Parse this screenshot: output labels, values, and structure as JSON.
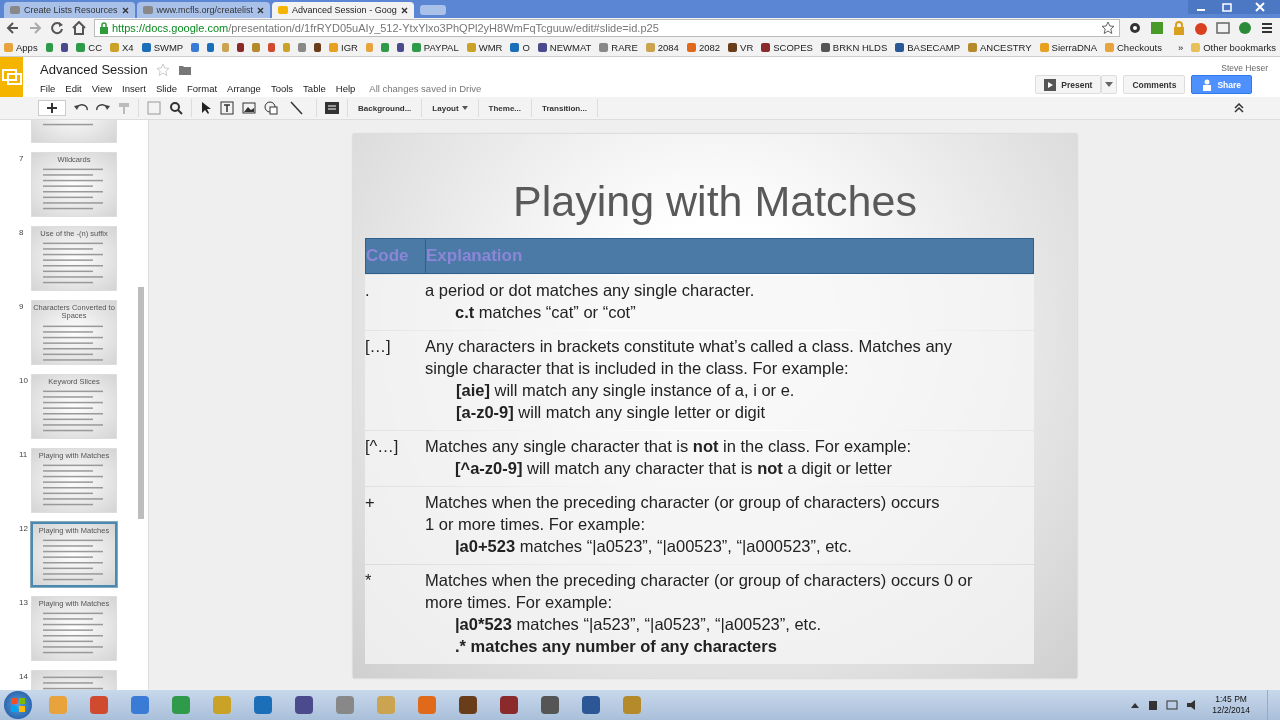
{
  "browser": {
    "tabs": [
      {
        "title": "Create Lists Resources",
        "selected": false
      },
      {
        "title": "www.mcfls.org/createlist",
        "selected": false
      },
      {
        "title": "Advanced Session - Goog",
        "selected": true
      }
    ],
    "url_host": "https://docs.google.com",
    "url_path": "/presentation/d/1frRYD05uAIy_512-YtxYlxo3PhQPl2yH8WmFqTcguuw/edit#slide=id.p25",
    "bookmarks": [
      {
        "kind": "labeled",
        "label": "Apps"
      },
      {
        "kind": "icon"
      },
      {
        "kind": "icon"
      },
      {
        "kind": "labeled",
        "label": "CC"
      },
      {
        "kind": "labeled",
        "label": "X4"
      },
      {
        "kind": "labeled",
        "label": "SWMP"
      },
      {
        "kind": "icon"
      },
      {
        "kind": "icon"
      },
      {
        "kind": "icon"
      },
      {
        "kind": "icon"
      },
      {
        "kind": "icon"
      },
      {
        "kind": "icon"
      },
      {
        "kind": "icon"
      },
      {
        "kind": "icon"
      },
      {
        "kind": "icon"
      },
      {
        "kind": "labeled",
        "label": "IGR"
      },
      {
        "kind": "icon"
      },
      {
        "kind": "icon"
      },
      {
        "kind": "icon"
      },
      {
        "kind": "labeled",
        "label": "PAYPAL"
      },
      {
        "kind": "labeled",
        "label": "WMR"
      },
      {
        "kind": "labeled",
        "label": "O"
      },
      {
        "kind": "labeled",
        "label": "NEWMAT"
      },
      {
        "kind": "labeled",
        "label": "RARE"
      },
      {
        "kind": "labeled",
        "label": "2084"
      },
      {
        "kind": "labeled",
        "label": "2082"
      },
      {
        "kind": "labeled",
        "label": "VR"
      },
      {
        "kind": "labeled",
        "label": "SCOPES"
      },
      {
        "kind": "labeled",
        "label": "BRKN HLDS"
      },
      {
        "kind": "labeled",
        "label": "BASECAMP"
      },
      {
        "kind": "labeled",
        "label": "ANCESTRY"
      },
      {
        "kind": "labeled",
        "label": "SierraDNA"
      },
      {
        "kind": "labeled",
        "label": "Checkouts"
      }
    ],
    "more": "»",
    "other_bookmarks": "Other bookmarks"
  },
  "docs": {
    "title": "Advanced Session",
    "menus": [
      "File",
      "Edit",
      "View",
      "Insert",
      "Slide",
      "Format",
      "Arrange",
      "Tools",
      "Table",
      "Help"
    ],
    "save_status": "All changes saved in Drive",
    "user": "Steve Heser",
    "present": "Present",
    "comments": "Comments",
    "share": "Share",
    "toolbar_buttons": [
      {
        "label": "Background...",
        "dropdown": false
      },
      {
        "label": "Layout",
        "dropdown": true
      },
      {
        "label": "Theme...",
        "dropdown": false
      },
      {
        "label": "Transition...",
        "dropdown": false
      }
    ]
  },
  "filmstrip": [
    {
      "selected": false
    },
    {
      "number": "7",
      "title": "Wildcards",
      "selected": false
    },
    {
      "number": "8",
      "title": "Use of the -(n) suffix",
      "selected": false
    },
    {
      "number": "9",
      "title": "Characters Converted to Spaces",
      "selected": false
    },
    {
      "number": "10",
      "title": "Keyword Slices",
      "selected": false
    },
    {
      "number": "11",
      "title": "Playing with Matches",
      "selected": false
    },
    {
      "number": "12",
      "title": "Playing with Matches",
      "selected": true
    },
    {
      "number": "13",
      "title": "Playing with Matches",
      "selected": false
    },
    {
      "number": "14",
      "selected": false
    }
  ],
  "slide": {
    "title": "Playing with Matches",
    "columns": [
      "Code",
      "Explanation"
    ],
    "rows": [
      {
        "code": ".",
        "lines": [
          {
            "text": "a period or dot matches any single character."
          },
          {
            "term": "c.t",
            "text": "matches “cat” or “cot”"
          }
        ]
      },
      {
        "code": "[…]",
        "lines": [
          {
            "text": "Any characters in brackets constitute what’s called a class. Matches any"
          },
          {
            "text": "single character that is included in the class.  For example:"
          },
          {
            "term": "[aie]",
            "text": " will match any single instance of a, i or e."
          },
          {
            "term": "[a-z0-9]",
            "text": " will match any single letter or digit"
          }
        ]
      },
      {
        "code": "[^…]",
        "lines": [
          {
            "text": "Matches any single character that is **not** in the class. For example:"
          },
          {
            "term": "[^a-z0-9]",
            "text": "will match any character that is **not** a digit or letter"
          }
        ]
      },
      {
        "code": "+",
        "lines": [
          {
            "text": "Matches when the preceding character (or group of characters) occurs"
          },
          {
            "text": "1 or more times. For example:"
          },
          {
            "term": "|a0+523",
            "text": " matches “|a0523”, “|a00523”, “|a000523”, etc."
          }
        ]
      },
      {
        "code": "*",
        "lines": [
          {
            "text": "Matches when the preceding character (or group of characters) occurs 0 or"
          },
          {
            "text": "more times.  For example:"
          },
          {
            "term": "|a0*523",
            "text": " matches “|a523”, “|a0523”, “|a00523”, etc."
          },
          {
            "term": ".* matches any number of any characters"
          }
        ]
      }
    ]
  },
  "taskbar": {
    "time": "1:45 PM",
    "date": "12/2/2014"
  }
}
